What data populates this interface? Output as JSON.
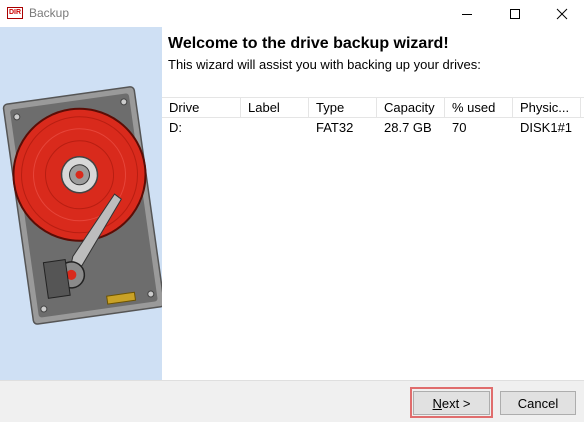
{
  "window": {
    "title": "Backup",
    "icon_text": "DIR",
    "minimize_icon": "minimize-icon",
    "maximize_icon": "maximize-icon",
    "close_icon": "close-icon"
  },
  "sidebar": {
    "image": "hard-drive-illustration"
  },
  "main": {
    "heading": "Welcome to the drive backup wizard!",
    "subheading": "This wizard will assist you with backing up your drives:"
  },
  "table": {
    "columns": [
      "Drive",
      "Label",
      "Type",
      "Capacity",
      "% used",
      "Physic..."
    ],
    "rows": [
      [
        "D:",
        "",
        "FAT32",
        "28.7 GB",
        "70",
        "DISK1#1"
      ]
    ]
  },
  "buttons": {
    "next": "Next >",
    "cancel": "Cancel"
  },
  "colors": {
    "sidebar_bg": "#cfe0f4",
    "platter_red": "#d92a1c",
    "focus_outline": "#e06d6d",
    "button_bg": "#e1e1e1"
  }
}
